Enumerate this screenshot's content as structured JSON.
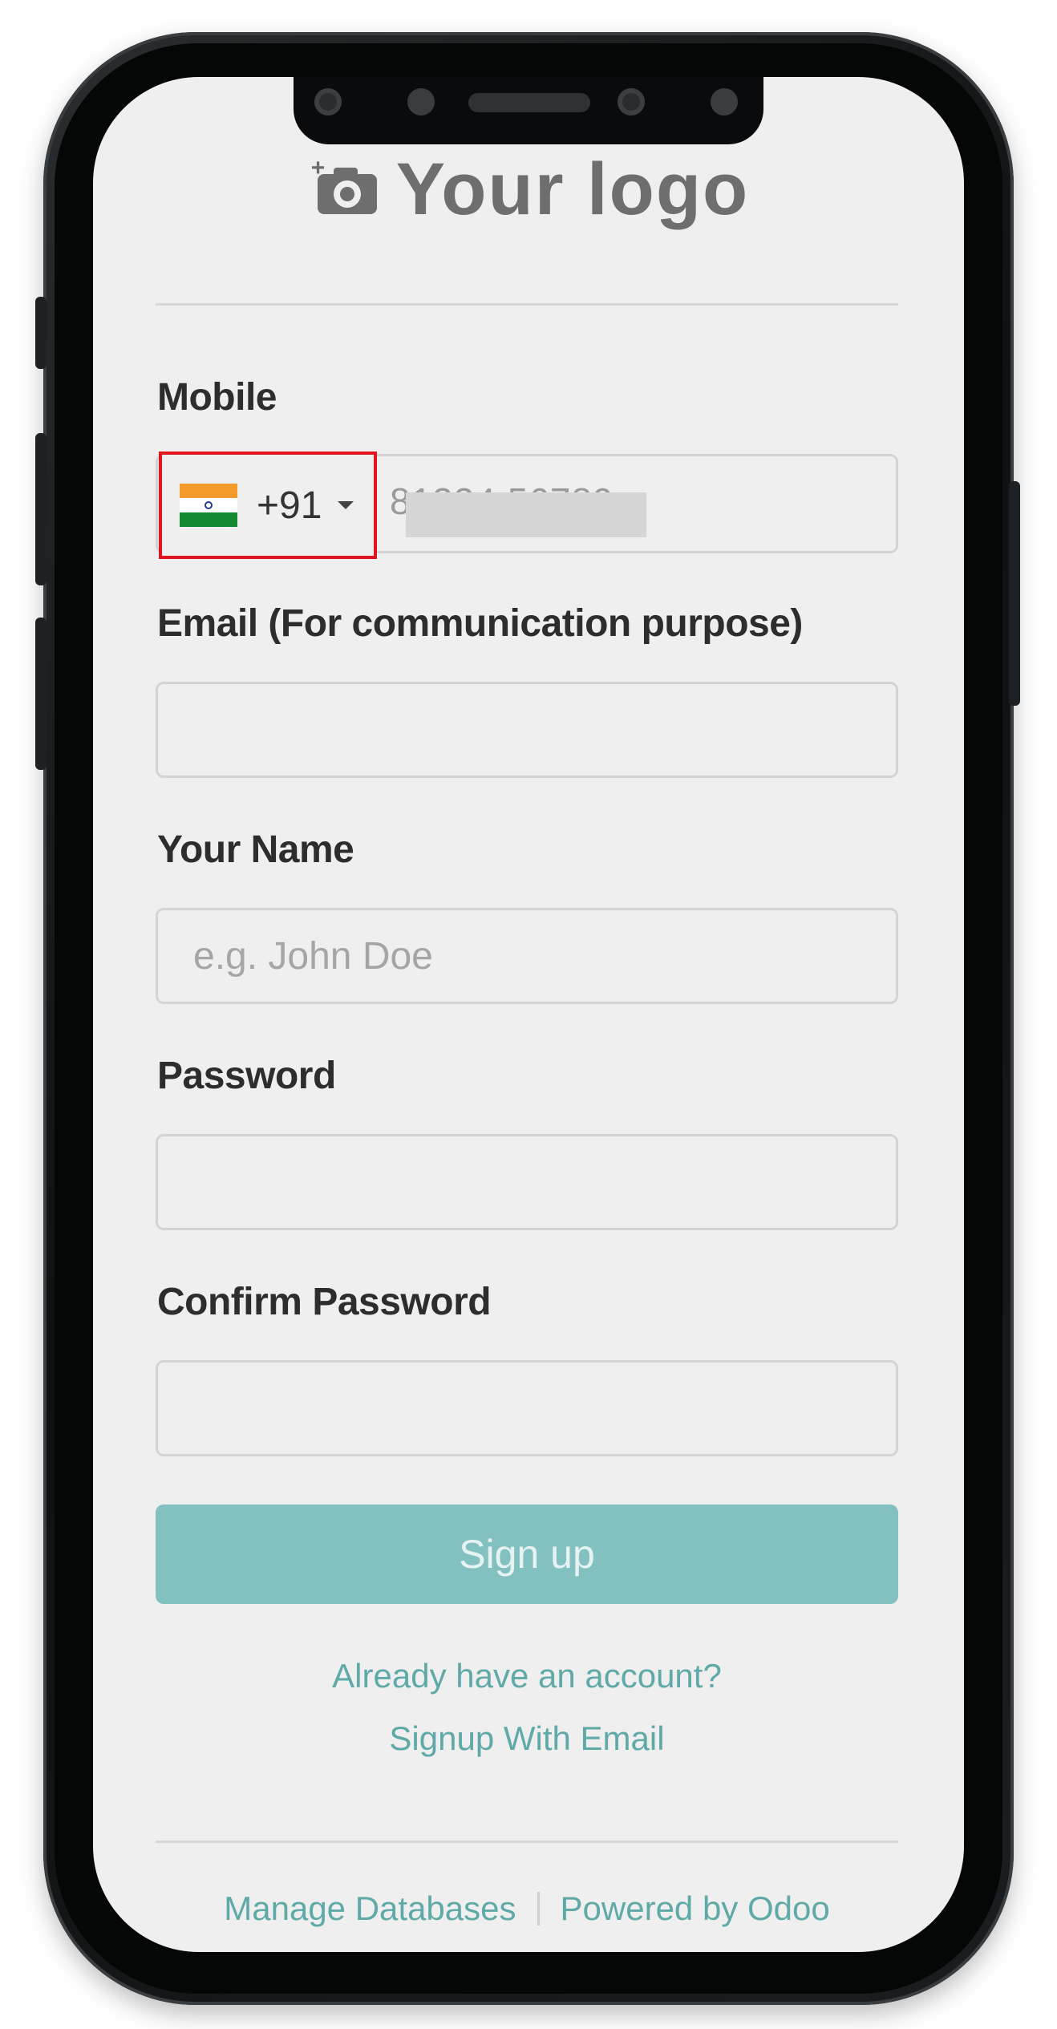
{
  "logo": {
    "text": "Your logo",
    "icon": "camera-add-icon"
  },
  "form": {
    "mobile": {
      "label": "Mobile",
      "flag": "india-flag-icon",
      "dial_code": "+91",
      "value": "81234 56789"
    },
    "email": {
      "label": "Email (For communication purpose)",
      "value": ""
    },
    "name": {
      "label": "Your Name",
      "placeholder": "e.g. John Doe",
      "value": ""
    },
    "password": {
      "label": "Password",
      "value": ""
    },
    "confirm_password": {
      "label": "Confirm Password",
      "value": ""
    },
    "signup_button": "Sign up"
  },
  "links": {
    "already_account": "Already have an account?",
    "signup_email": "Signup With Email"
  },
  "footer": {
    "manage_databases": "Manage Databases",
    "powered_by": "Powered by Odoo"
  },
  "colors": {
    "accent": "#82c1bf",
    "link": "#5fa9a7",
    "highlight_border": "#e0151d",
    "screen_bg": "#efefef"
  }
}
